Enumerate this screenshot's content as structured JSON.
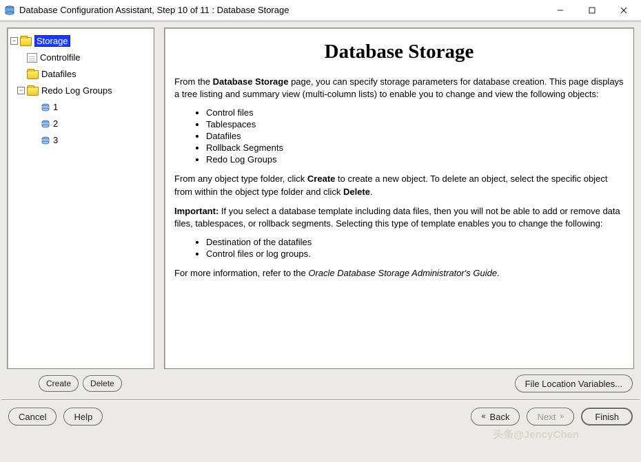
{
  "window": {
    "title": "Database Configuration Assistant, Step 10 of 11 : Database Storage"
  },
  "tree": {
    "root": "Storage",
    "controlfile": "Controlfile",
    "datafiles": "Datafiles",
    "redo_groups": "Redo Log Groups",
    "redo_children": [
      "1",
      "2",
      "3"
    ]
  },
  "content": {
    "heading": "Database Storage",
    "p1_a": "From the ",
    "p1_b_bold": "Database Storage",
    "p1_c": " page, you can specify storage parameters for database creation. This page displays a tree listing and summary view (multi-column lists) to enable you to change and view the following objects:",
    "list1": [
      "Control files",
      "Tablespaces",
      "Datafiles",
      "Rollback Segments",
      "Redo Log Groups"
    ],
    "p2_a": "From any object type folder, click ",
    "p2_b_bold": "Create",
    "p2_c": " to create a new object. To delete an object, select the specific object from within the object type folder and click ",
    "p2_d_bold": "Delete",
    "p2_e": ".",
    "p3_a_bold": "Important:",
    "p3_b": " If you select a database template including data files, then you will not be able to add or remove data files, tablespaces, or rollback segments. Selecting this type of template enables you to change the following:",
    "list2": [
      "Destination of the datafiles",
      "Control files or log groups."
    ],
    "p4_a": "For more information, refer to the ",
    "p4_b_italic": "Oracle Database Storage Administrator's Guide",
    "p4_c": "."
  },
  "buttons": {
    "create": "Create",
    "delete": "Delete",
    "filevars": "File Location Variables...",
    "cancel": "Cancel",
    "help": "Help",
    "back": "Back",
    "next": "Next",
    "finish": "Finish"
  },
  "watermark": "头条@JencyChen"
}
